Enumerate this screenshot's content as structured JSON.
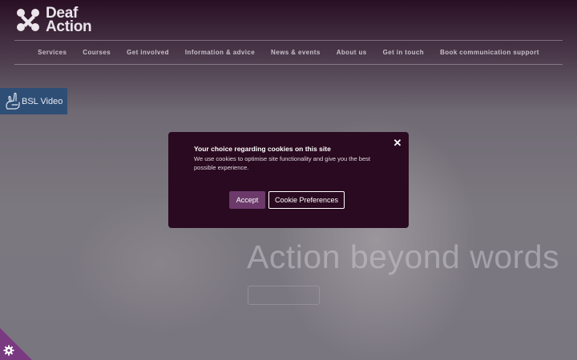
{
  "brand": {
    "line1": "Deaf",
    "line2": "Action"
  },
  "nav": {
    "items": [
      {
        "label": "Services"
      },
      {
        "label": "Courses"
      },
      {
        "label": "Get involved"
      },
      {
        "label": "Information & advice"
      },
      {
        "label": "News & events"
      },
      {
        "label": "About us"
      },
      {
        "label": "Get in touch"
      },
      {
        "label": "Book communication support"
      }
    ]
  },
  "bsl": {
    "label": "BSL Video",
    "icon": "signing-hand-icon"
  },
  "hero": {
    "title": "Action beyond words"
  },
  "cookie_modal": {
    "title": "Your choice regarding cookies on this site",
    "text": "We use cookies to optimise site functionality and give you the best possible experience.",
    "close_icon": "close-icon",
    "accept_label": "Accept",
    "preferences_label": "Cookie Preferences"
  },
  "cookie_settings": {
    "icon": "gear-icon"
  },
  "colors": {
    "modal_bg": "#2a0a20",
    "accept_bg": "#6b3a6b",
    "bsl_bg": "#2e4e76",
    "cookie_corner": "#7a3a82"
  }
}
